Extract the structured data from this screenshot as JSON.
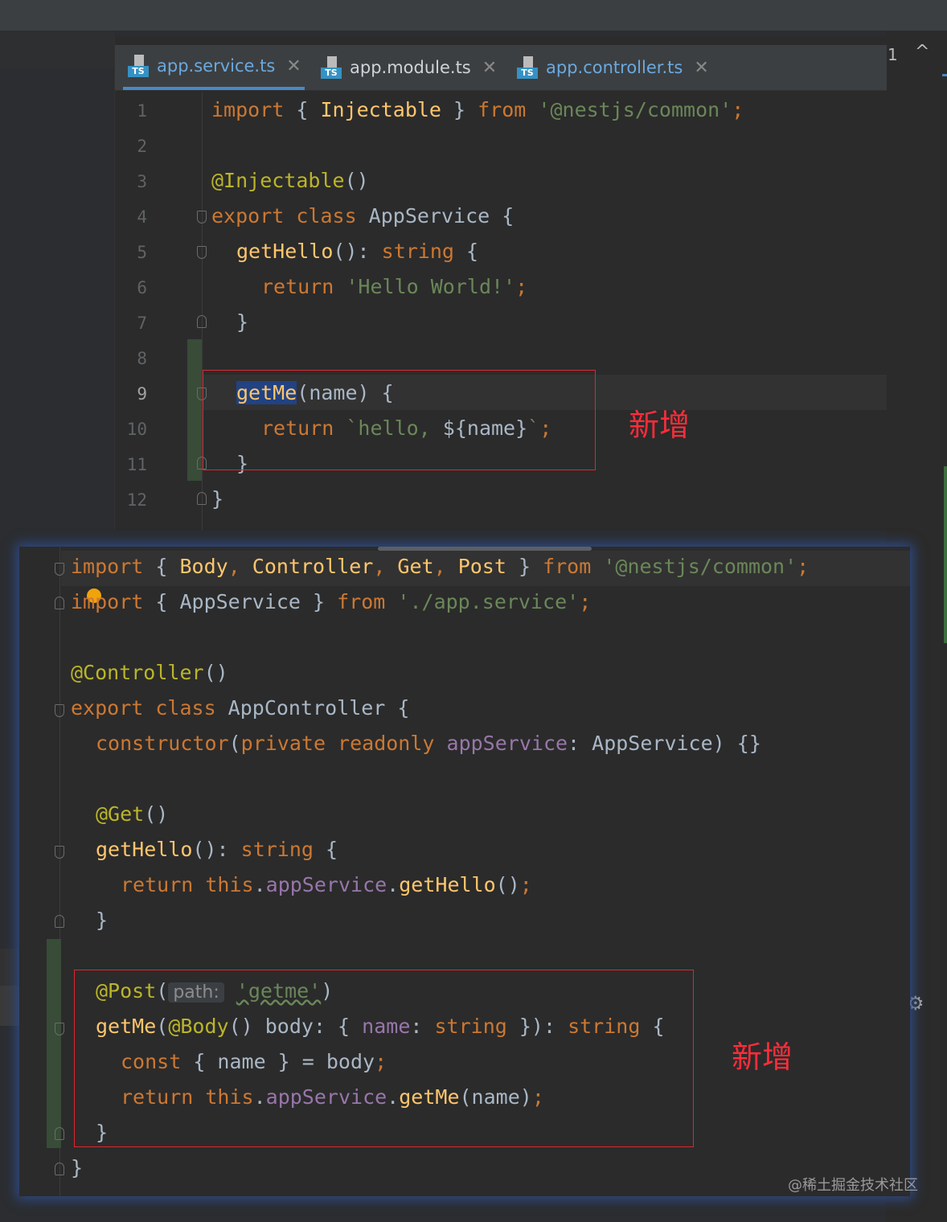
{
  "tabs": [
    {
      "name": "app.service.ts",
      "badge": "TS"
    },
    {
      "name": "app.module.ts",
      "badge": "TS"
    },
    {
      "name": "app.controller.ts",
      "badge": "TS"
    }
  ],
  "close_glyph": "✕",
  "right_panel": {
    "count": "1",
    "chevron": "^",
    "gear": "⚙"
  },
  "service_file": {
    "line_numbers": [
      "1",
      "2",
      "3",
      "4",
      "5",
      "6",
      "7",
      "8",
      "9",
      "10",
      "11",
      "12"
    ],
    "code": {
      "l1": {
        "a": "import",
        "b": " { ",
        "c": "Injectable",
        "d": " } ",
        "e": "from",
        "f": " ",
        "g": "'@nestjs/common'",
        "h": ";"
      },
      "l3": {
        "a": "@Injectable",
        "b": "()"
      },
      "l4": {
        "a": "export class",
        "b": " AppService {"
      },
      "l5": {
        "a": "getHello",
        "b": "(): ",
        "c": "string",
        "d": " {"
      },
      "l6": {
        "a": "return",
        "b": " ",
        "c": "'Hello World!'",
        "d": ";"
      },
      "l7": {
        "a": "}"
      },
      "l9": {
        "a": "getMe",
        "b": "(name) {"
      },
      "l10": {
        "a": "return",
        "b": " ",
        "c": "`hello, ",
        "d": "${name}",
        "e": "`",
        "f": ";"
      },
      "l11": {
        "a": "}"
      },
      "l12": {
        "a": "}"
      }
    },
    "annotation": "新增"
  },
  "controller_file": {
    "code": {
      "l1": {
        "a": "import",
        "b": " { ",
        "c": "Body",
        "d": ", ",
        "e": "Controller",
        "f": ", ",
        "g": "Get",
        "h": ", ",
        "i": "Post",
        "j": " } ",
        "k": "from",
        "l": " ",
        "m": "'@nestjs/common'",
        "n": ";"
      },
      "l2": {
        "a": "import",
        "b": " { AppService } ",
        "c": "from",
        "d": " ",
        "e": "'./app.service'",
        "f": ";"
      },
      "l4": {
        "a": "@Controller",
        "b": "()"
      },
      "l5": {
        "a": "export class",
        "b": " AppController {"
      },
      "l6": {
        "a": "constructor",
        "b": "(",
        "c": "private readonly",
        "d": " ",
        "e": "appService",
        "f": ": AppService) {}"
      },
      "l8": {
        "a": "@Get",
        "b": "()"
      },
      "l9": {
        "a": "getHello",
        "b": "(): ",
        "c": "string",
        "d": " {"
      },
      "l10": {
        "a": "return",
        "b": " ",
        "c": "this",
        "d": ".",
        "e": "appService",
        "f": ".",
        "g": "getHello",
        "h": "()",
        "i": ";"
      },
      "l11": {
        "a": "}"
      },
      "l13": {
        "a": "@Post",
        "b": "(",
        "c": "path:",
        "d": " ",
        "e": "'getme'",
        "f": ")"
      },
      "l14": {
        "a": "getMe",
        "b": "(",
        "c": "@Body",
        "d": "() body: { ",
        "e": "name",
        "f": ": ",
        "g": "string",
        "h": " }): ",
        "i": "string",
        "j": " {"
      },
      "l15": {
        "a": "const",
        "b": " { name } = body",
        "c": ";"
      },
      "l16": {
        "a": "return",
        "b": " ",
        "c": "this",
        "d": ".",
        "e": "appService",
        "f": ".",
        "g": "getMe",
        "h": "(name)",
        "i": ";"
      },
      "l17": {
        "a": "}"
      },
      "l18": {
        "a": "}"
      }
    },
    "annotation": "新增"
  },
  "watermark": "@稀土掘金技术社区"
}
